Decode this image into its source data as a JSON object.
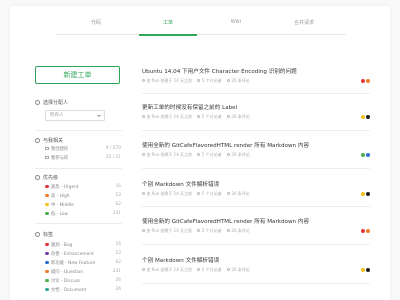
{
  "tabs": [
    {
      "label": "代码",
      "active": false
    },
    {
      "label": "工单",
      "active": true
    },
    {
      "label": "Wiki",
      "active": false
    },
    {
      "label": "合并请求",
      "active": false
    }
  ],
  "sidebar": {
    "new_button": "新建工单",
    "assignee": {
      "label": "选择分配人",
      "placeholder": "所有人"
    },
    "related": {
      "label": "与我相关",
      "items": [
        {
          "label": "我创建的",
          "count": "9 / 270"
        },
        {
          "label": "我参与的",
          "count": "25 / 51"
        }
      ]
    },
    "priority": {
      "label": "优先级",
      "items": [
        {
          "label": "紧急 - Urgent",
          "count": "16",
          "color": "#e5363c"
        },
        {
          "label": "高 - High",
          "count": "53",
          "color": "#f07d2a"
        },
        {
          "label": "中 - Middle",
          "count": "62",
          "color": "#f4c21b"
        },
        {
          "label": "低 - Low",
          "count": "241",
          "color": "#4caf50"
        }
      ]
    },
    "labels": {
      "label": "标签",
      "items": [
        {
          "label": "漏洞 - Bug",
          "count": "16",
          "color": "#e5363c"
        },
        {
          "label": "改善 - Enhancement",
          "count": "53",
          "color": "#7b3fa0"
        },
        {
          "label": "新功能 - New Feature",
          "count": "62",
          "color": "#2f6fd1"
        },
        {
          "label": "疑问 - Question",
          "count": "241",
          "color": "#f07d2a"
        },
        {
          "label": "讨论 - Discuss",
          "count": "26",
          "color": "#4caf50"
        },
        {
          "label": "文档 - Document",
          "count": "26",
          "color": "#2fa5a0"
        }
      ]
    }
  },
  "issues": [
    {
      "title": "Ubuntu 14.04 下用户文件 Character Encoding 识别的问题",
      "author": "由 fivo 创建于 14 天之前",
      "comments": "5 个讨论者",
      "votes": "26 条评论",
      "tags": [
        "#e5363c",
        "#f07d2a"
      ]
    },
    {
      "title": "更新工单的时候没有保留之前的 Label",
      "author": "由 fivo 创建于 14 天之前",
      "comments": "5 个讨论者",
      "votes": "26 条评论",
      "tags": [
        "#f4c21b",
        "#222222"
      ]
    },
    {
      "title": "使用全新的 GitCafeFlavoredHTML render 所有 Markdown 内容",
      "author": "由 fivo 创建于 14 天之前",
      "comments": "5 个讨论者",
      "votes": "26 条评论",
      "tags": [
        "#4caf50",
        "#2f6fd1"
      ]
    },
    {
      "title": "个别 Markdown 文件解析错误",
      "author": "由 fivo 创建于 14 天之前",
      "comments": "5 个讨论者",
      "votes": "26 条评论",
      "tags": [
        "#f4c21b",
        "#222222"
      ]
    },
    {
      "title": "使用全新的 GitCafeFlavoredHTML render 所有 Markdown 内容",
      "author": "由 fivo 创建于 14 天之前",
      "comments": "5 个讨论者",
      "votes": "26 条评论",
      "tags": [
        "#e5363c",
        "#f07d2a"
      ]
    },
    {
      "title": "个别 Markdown 文件解析错误",
      "author": "由 fivo 创建于 14 天之前",
      "comments": "5 个讨论者",
      "votes": "26 条评论",
      "tags": [
        "#f4c21b",
        "#222222"
      ]
    }
  ]
}
